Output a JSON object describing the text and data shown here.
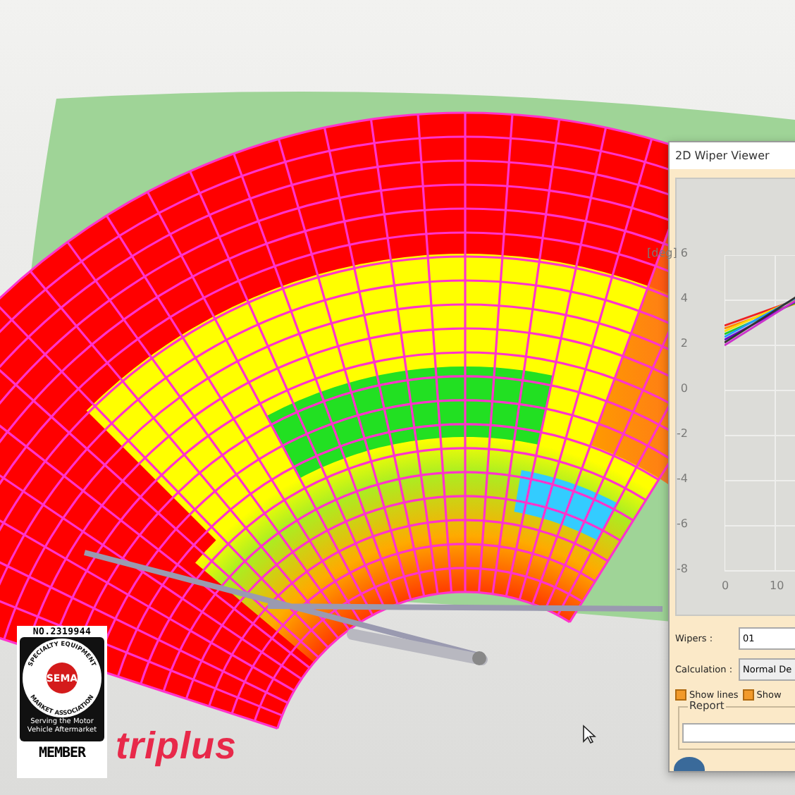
{
  "badge": {
    "number": "NO.2319944",
    "ring_top": "SPECIALTY EQUIPMENT",
    "ring_bottom": "MARKET ASSOCIATION",
    "emblem": "SEMA",
    "tagline": "Serving the Motor Vehicle Aftermarket",
    "footer": "MEMBER"
  },
  "brand": {
    "name": "triplus"
  },
  "dialog": {
    "title": "2D Wiper Viewer",
    "plot": {
      "y_unit": "[deg]",
      "y_ticks": [
        "6",
        "4",
        "2",
        "0",
        "-2",
        "-4",
        "-6",
        "-8"
      ],
      "x_ticks": [
        "0",
        "10"
      ]
    },
    "fields": [
      {
        "label": "Wipers :",
        "kind": "input",
        "value": "01"
      },
      {
        "label": "Calculation :",
        "kind": "select",
        "value": "Normal De"
      }
    ],
    "checkboxes": [
      {
        "label": "Show lines",
        "checked": true
      },
      {
        "label": "Show",
        "checked": true
      }
    ],
    "report": {
      "legend": "Report"
    }
  }
}
